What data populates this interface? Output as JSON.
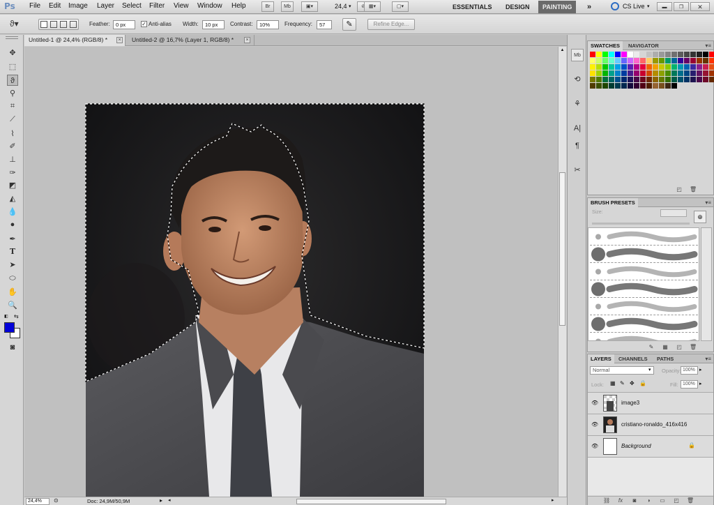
{
  "app": {
    "logo": "Ps"
  },
  "menu": [
    "File",
    "Edit",
    "Image",
    "Layer",
    "Select",
    "Filter",
    "View",
    "Window",
    "Help"
  ],
  "appbar": {
    "br": "Br",
    "mb": "Mb",
    "zoom": "24,4"
  },
  "workspaces": {
    "essentials": "ESSENTIALS",
    "design": "DESIGN",
    "painting": "PAINTING",
    "more": "»",
    "cslive": "CS Live"
  },
  "options": {
    "feather_label": "Feather:",
    "feather_value": "0 px",
    "antialias_label": "Anti-alias",
    "antialias_checked": "✓",
    "width_label": "Width:",
    "width_value": "10 px",
    "contrast_label": "Contrast:",
    "contrast_value": "10%",
    "frequency_label": "Frequency:",
    "frequency_value": "57",
    "refine_edge": "Refine Edge..."
  },
  "tabs": [
    {
      "label": "Untitled-1 @ 24,4% (RGB/8) *"
    },
    {
      "label": "Untitled-2 @ 16,7% (Layer 1, RGB/8) *"
    }
  ],
  "status": {
    "zoom": "24,4%",
    "doc": "Doc: 24,9M/50,9M"
  },
  "colors": {
    "foreground": "#0000d8",
    "background": "#ffffff"
  },
  "panels": {
    "swatches": "SWATCHES",
    "navigator": "NAVIGATOR",
    "brush_presets": "BRUSH PRESETS",
    "size_label": "Size:",
    "layers": "LAYERS",
    "channels": "CHANNELS",
    "paths": "PATHS",
    "blend_mode": "Normal",
    "opacity_label": "Opacity:",
    "opacity_value": "100%",
    "lock_label": "Lock:",
    "fill_label": "Fill:",
    "fill_value": "100%"
  },
  "layers": [
    {
      "name": "image3"
    },
    {
      "name": "cristiano-ronaldo_416x416"
    },
    {
      "name": "Background",
      "locked": "🔒"
    }
  ],
  "swatch_colors": [
    "#ff0000",
    "#ffff00",
    "#00ff00",
    "#00ffff",
    "#0000ff",
    "#ff00ff",
    "#ffffff",
    "#ebebeb",
    "#d6d6d6",
    "#c2c2c2",
    "#adadad",
    "#999999",
    "#858585",
    "#707070",
    "#5c5c5c",
    "#474747",
    "#333333",
    "#1f1f1f",
    "#000000",
    "#ff0000",
    "#ffff66",
    "#ccff66",
    "#66ff66",
    "#66ffcc",
    "#66ccff",
    "#6666ff",
    "#cc66ff",
    "#ff66cc",
    "#ff6666",
    "#ffcc66",
    "#999900",
    "#669900",
    "#009966",
    "#006699",
    "#330099",
    "#660066",
    "#990033",
    "#993300",
    "#663300",
    "#ff3300",
    "#fff200",
    "#b8e000",
    "#00c800",
    "#00c8a0",
    "#00a0e8",
    "#0050c8",
    "#5a1eb4",
    "#b4008c",
    "#e6003c",
    "#f06400",
    "#f0a000",
    "#c8c800",
    "#8cc800",
    "#00b46e",
    "#0096b4",
    "#0064b4",
    "#3c28a0",
    "#8c1e8c",
    "#c81e50",
    "#e65014",
    "#ffe100",
    "#a0d200",
    "#00b400",
    "#00a08c",
    "#0082c8",
    "#003ca0",
    "#461e8c",
    "#96006e",
    "#c8002d",
    "#d24600",
    "#b48c00",
    "#8ca000",
    "#4b8c00",
    "#00785a",
    "#006e8c",
    "#004682",
    "#281e6e",
    "#641464",
    "#961432",
    "#a03200",
    "#787800",
    "#507800",
    "#006e3c",
    "#006464",
    "#00508c",
    "#00286e",
    "#1e145a",
    "#460a46",
    "#6e0a1e",
    "#6e2800",
    "#8c6400",
    "#647800",
    "#326e00",
    "#005a46",
    "#00506e",
    "#003264",
    "#1e1450",
    "#4b0a4b",
    "#6e0a28",
    "#642800",
    "#503c00",
    "#3c5000",
    "#1e4600",
    "#003c32",
    "#003c50",
    "#002850",
    "#140a3c",
    "#320032",
    "#500014",
    "#501e00",
    "#966432",
    "#78501e",
    "#3c2814",
    "#000000"
  ]
}
